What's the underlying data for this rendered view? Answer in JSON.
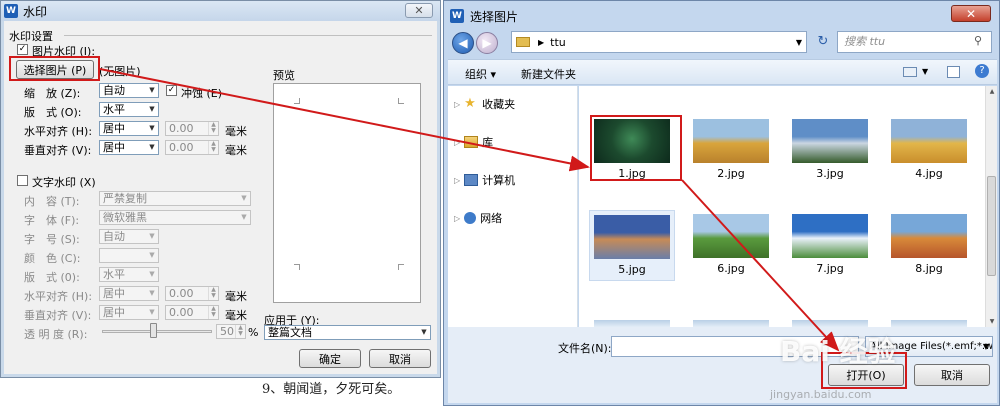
{
  "doc": {
    "text": "9、朝闻道，夕死可矣。"
  },
  "watermark_dialog": {
    "app_icon": "W",
    "title": "水印",
    "close": "✕",
    "section_title": "水印设置",
    "picture": {
      "checkbox_label": "图片水印 (I):",
      "checked": true,
      "choose_button": "选择图片 (P)",
      "no_picture": "(无图片)",
      "scale_label": "缩　放 (Z):",
      "scale_value": "自动",
      "washout_label": "冲蚀 (E)",
      "washout_checked": true,
      "layout_label": "版　式 (O):",
      "layout_value": "水平",
      "h_align_label": "水平对齐 (H):",
      "h_align_value": "居中",
      "h_offset": "0.00",
      "v_align_label": "垂直对齐 (V):",
      "v_align_value": "居中",
      "v_offset": "0.00",
      "unit": "毫米"
    },
    "text": {
      "checkbox_label": "文字水印 (X)",
      "checked": false,
      "content_label": "内　容 (T):",
      "content_value": "严禁复制",
      "font_label": "字　体 (F):",
      "font_value": "微软雅黑",
      "size_label": "字　号 (S):",
      "size_value": "自动",
      "color_label": "颜　色 (C):",
      "layout_label": "版　式 (0):",
      "layout_value": "水平",
      "h_align_label": "水平对齐 (H):",
      "h_align_value": "居中",
      "h_offset": "0.00",
      "v_align_label": "垂直对齐 (V):",
      "v_align_value": "居中",
      "v_offset": "0.00",
      "unit": "毫米",
      "transparency_label": "透 明 度 (R):",
      "transparency_value": "50",
      "percent": "%"
    },
    "preview_label": "预览",
    "apply_label": "应用于 (Y):",
    "apply_value": "整篇文档",
    "ok": "确定",
    "cancel": "取消"
  },
  "file_dialog": {
    "title": "选择图片",
    "close": "✕",
    "path": [
      "ttu"
    ],
    "search_placeholder": "搜索 ttu",
    "toolbar": {
      "organize": "组织 ▾",
      "new_folder": "新建文件夹"
    },
    "nav": [
      "收藏夹",
      "库",
      "计算机",
      "网络"
    ],
    "files": [
      {
        "name": "1.jpg",
        "colors": [
          "#0d2a1c",
          "#3f8a57",
          "#1c4a2e"
        ]
      },
      {
        "name": "2.jpg",
        "colors": [
          "#9cc0e0",
          "#d9a53c",
          "#b9812c"
        ]
      },
      {
        "name": "3.jpg",
        "colors": [
          "#5f8ec7",
          "#cad6e2",
          "#355b2b"
        ]
      },
      {
        "name": "4.jpg",
        "colors": [
          "#8fb2d8",
          "#e2b64a",
          "#c98e2c"
        ]
      },
      {
        "name": "5.jpg",
        "colors": [
          "#3a5da6",
          "#c78b57",
          "#6a7ea8"
        ]
      },
      {
        "name": "6.jpg",
        "colors": [
          "#a8c8e6",
          "#5a9b3e",
          "#3e7128"
        ]
      },
      {
        "name": "7.jpg",
        "colors": [
          "#2e6fc4",
          "#e9f1fa",
          "#4b8d3b"
        ]
      },
      {
        "name": "8.jpg",
        "colors": [
          "#77a7d8",
          "#d88a3a",
          "#b6552b"
        ]
      }
    ],
    "filename_label": "文件名(N):",
    "filetype_value": "All Image Files(*.emf;*.wmf *",
    "open_button": "打开(O)",
    "cancel_button": "取消"
  },
  "overlay": {
    "logo": "Bai 经验",
    "url": "jingyan.baidu.com"
  }
}
